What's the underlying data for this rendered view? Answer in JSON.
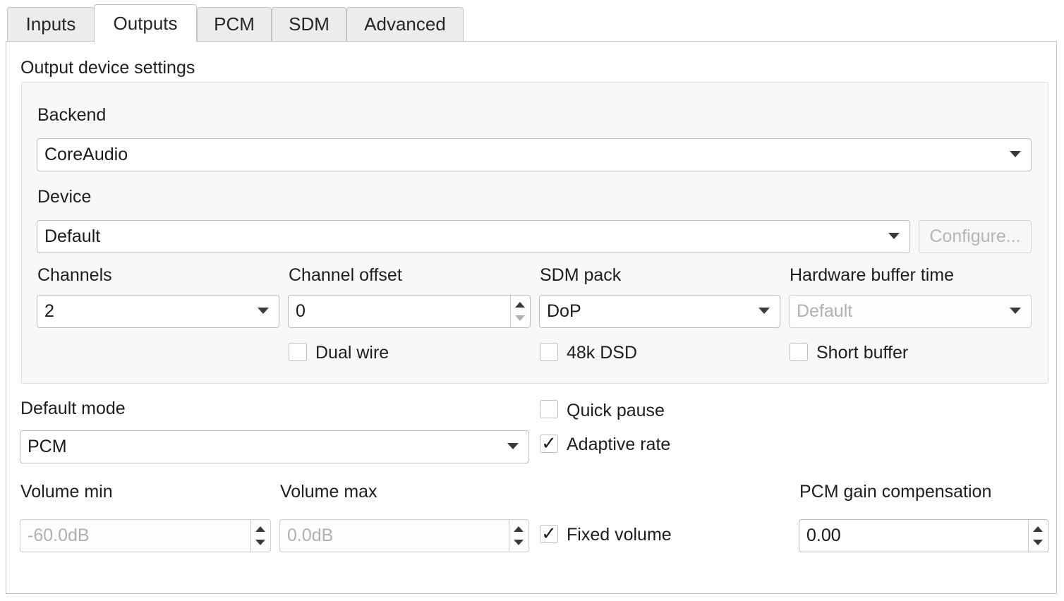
{
  "tabs": [
    {
      "label": "Inputs",
      "active": false
    },
    {
      "label": "Outputs",
      "active": true
    },
    {
      "label": "PCM",
      "active": false
    },
    {
      "label": "SDM",
      "active": false
    },
    {
      "label": "Advanced",
      "active": false
    }
  ],
  "output_device": {
    "group_title": "Output device settings",
    "backend_label": "Backend",
    "backend_value": "CoreAudio",
    "device_label": "Device",
    "device_value": "Default",
    "configure_label": "Configure...",
    "channels_label": "Channels",
    "channels_value": "2",
    "channel_offset_label": "Channel offset",
    "channel_offset_value": "0",
    "sdm_pack_label": "SDM pack",
    "sdm_pack_value": "DoP",
    "hw_buffer_label": "Hardware buffer time",
    "hw_buffer_value": "Default",
    "dual_wire_label": "Dual wire",
    "dual_wire_checked": false,
    "dsd48k_label": "48k DSD",
    "dsd48k_checked": false,
    "short_buffer_label": "Short buffer",
    "short_buffer_checked": false
  },
  "mode": {
    "default_mode_label": "Default mode",
    "default_mode_value": "PCM",
    "quick_pause_label": "Quick pause",
    "quick_pause_checked": false,
    "adaptive_rate_label": "Adaptive rate",
    "adaptive_rate_checked": true
  },
  "volume": {
    "min_label": "Volume min",
    "min_value": "-60.0dB",
    "max_label": "Volume max",
    "max_value": "0.0dB",
    "fixed_label": "Fixed volume",
    "fixed_checked": true,
    "gain_label": "PCM gain compensation",
    "gain_value": "0.00"
  },
  "glyphs": {
    "check": "✓"
  }
}
